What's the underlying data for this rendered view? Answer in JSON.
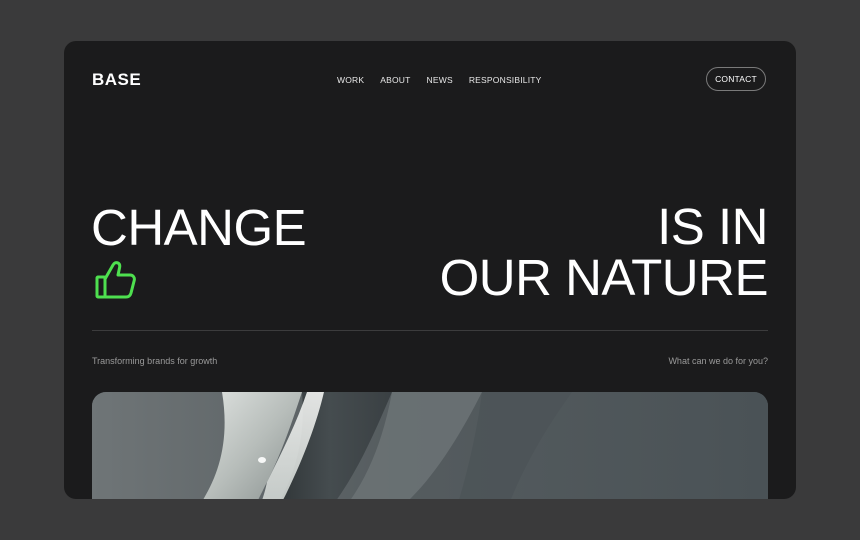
{
  "brand": {
    "logo": "BASE"
  },
  "nav": {
    "items": [
      {
        "label": "WORK"
      },
      {
        "label": "ABOUT"
      },
      {
        "label": "NEWS"
      },
      {
        "label": "RESPONSIBILITY"
      }
    ],
    "contact_label": "CONTACT"
  },
  "hero": {
    "left_text": "CHANGE",
    "right_line1": "IS IN",
    "right_line2": "OUR NATURE",
    "icon": "thumbs-up-icon",
    "icon_color": "#4ee04f"
  },
  "taglines": {
    "left": "Transforming brands for growth",
    "right": "What can we do for you?"
  },
  "colors": {
    "background": "#3a3a3b",
    "card": "#1b1b1c",
    "accent": "#4ee04f",
    "text": "#ffffff",
    "muted": "#9a9a9a"
  }
}
